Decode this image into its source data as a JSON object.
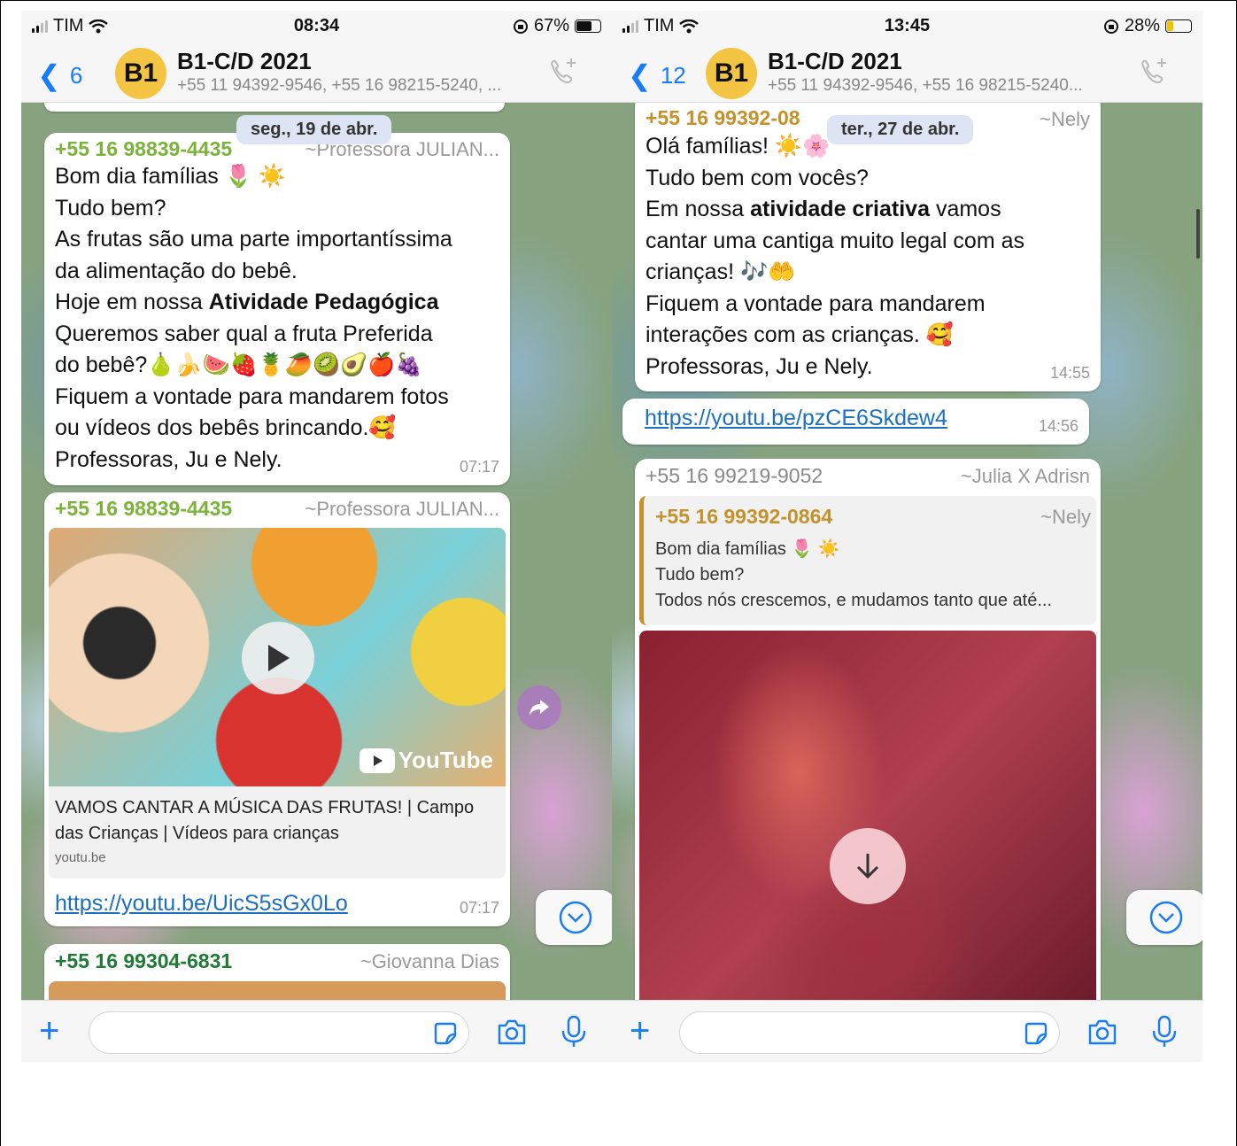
{
  "left": {
    "status": {
      "carrier": "TIM",
      "time": "08:34",
      "battery": "67%",
      "battery_color": "#111111",
      "battery_level": 0.67
    },
    "header": {
      "back_count": "6",
      "avatar": "B1",
      "title": "B1-C/D 2021",
      "subtitle": "+55 11 94392-9546, +55 16 98215-5240, ..."
    },
    "date_pill": "seg., 19 de abr.",
    "msg1": {
      "sender": "+55 16 98839-4435",
      "alias": "~Professora JULIAN...",
      "lines": [
        "Bom dia famílias 🌷 ☀️",
        "Tudo bem?",
        "As frutas são uma parte importantíssima",
        "da alimentação do bebê.",
        "Hoje em nossa ",
        "Queremos saber qual a fruta Preferida",
        "do bebê?🍐🍌🍉🍓🍍🥭🥝🥑🍎🍇",
        "Fiquem a vontade para mandarem fotos",
        "ou vídeos dos bebês brincando.🥰",
        "Professoras, Ju e Nely."
      ],
      "bold_phrase": "Atividade Pedagógica",
      "time": "07:17"
    },
    "msg2": {
      "sender": "+55 16 98839-4435",
      "alias": "~Professora JULIAN...",
      "video_brand": "YouTube",
      "preview_title": "VAMOS CANTAR A MÚSICA DAS FRUTAS! | Campo das Crianças | Vídeos para crianças",
      "preview_domain": "youtu.be",
      "link": "https://youtu.be/UicS5sGx0Lo",
      "time": "07:17"
    },
    "msg3": {
      "sender": "+55 16 99304-6831",
      "alias": "~Giovanna Dias"
    }
  },
  "right": {
    "status": {
      "carrier": "TIM",
      "time": "13:45",
      "battery": "28%",
      "battery_color": "#f2c200",
      "battery_level": 0.28
    },
    "header": {
      "back_count": "12",
      "avatar": "B1",
      "title": "B1-C/D 2021",
      "subtitle": "+55 11 94392-9546, +55 16 98215-5240..."
    },
    "date_pill": "ter., 27 de abr.",
    "msg1": {
      "sender": "+55 16 99392-08",
      "alias": "~Nely",
      "lines": [
        "Olá famílias! ☀️🌸",
        "Tudo bem com vocês?",
        "Em nossa ",
        "cantar uma cantiga muito legal com as",
        "crianças! 🎶🤲",
        "Fiquem a vontade para mandarem",
        "interações com as crianças. 🥰",
        "Professoras, Ju e Nely."
      ],
      "bold_phrase": "atividade criativa",
      "after_bold": " vamos",
      "time": "14:55"
    },
    "msg2": {
      "link": "https://youtu.be/pzCE6Skdew4",
      "time": "14:56"
    },
    "msg3": {
      "sender": "+55 16 99219-9052",
      "alias": "~Julia X Adrisn",
      "quote_sender": "+55 16 99392-0864",
      "quote_alias": "~Nely",
      "quote_lines": [
        "Bom dia famílias 🌷 ☀️",
        "Tudo bem?",
        "Todos nós crescemos, e mudamos tanto que até..."
      ]
    }
  },
  "colors": {
    "accent": "#1a7cf5",
    "sender_green": "#7bb33a",
    "sender_dark_green": "#1f7a35",
    "sender_gold": "#c4912a",
    "avatar_yellow": "#f4c542"
  }
}
